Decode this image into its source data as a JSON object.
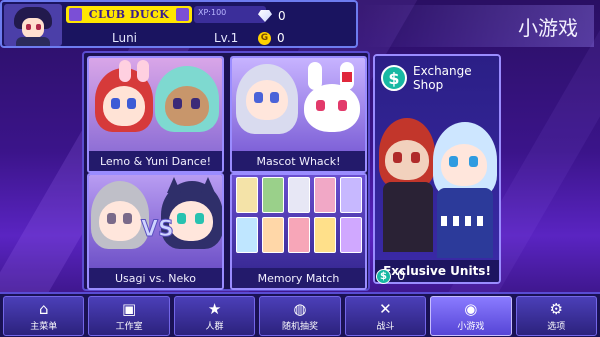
{
  "player": {
    "club_name": "CLUB DUCK",
    "xp_label": "XP:100",
    "name": "Luni",
    "level": "Lv.1",
    "diamonds": "0",
    "gold": "0",
    "gold_symbol": "G"
  },
  "page": {
    "title": "小游戏"
  },
  "games": [
    {
      "label": "Lemo & Yuni Dance!"
    },
    {
      "label": "Mascot Whack!"
    },
    {
      "label": "Usagi vs. Neko",
      "vs_text": "VS"
    },
    {
      "label": "Memory Match"
    }
  ],
  "shop": {
    "title_line1": "Exchange",
    "title_line2": "Shop",
    "symbol": "$",
    "caption": "Exclusive Units!",
    "balance": "0"
  },
  "nav": [
    {
      "label": "主菜单",
      "icon": "home-icon"
    },
    {
      "label": "工作室",
      "icon": "camera-icon"
    },
    {
      "label": "人群",
      "icon": "star-icon"
    },
    {
      "label": "随机抽奖",
      "icon": "planet-icon"
    },
    {
      "label": "战斗",
      "icon": "swords-icon"
    },
    {
      "label": "小游戏",
      "icon": "gamepad-icon",
      "active": true
    },
    {
      "label": "选项",
      "icon": "gear-icon"
    }
  ],
  "colors": {
    "accent": "#ffe600",
    "panel": "#1a1460",
    "teal": "#18b8a3"
  }
}
